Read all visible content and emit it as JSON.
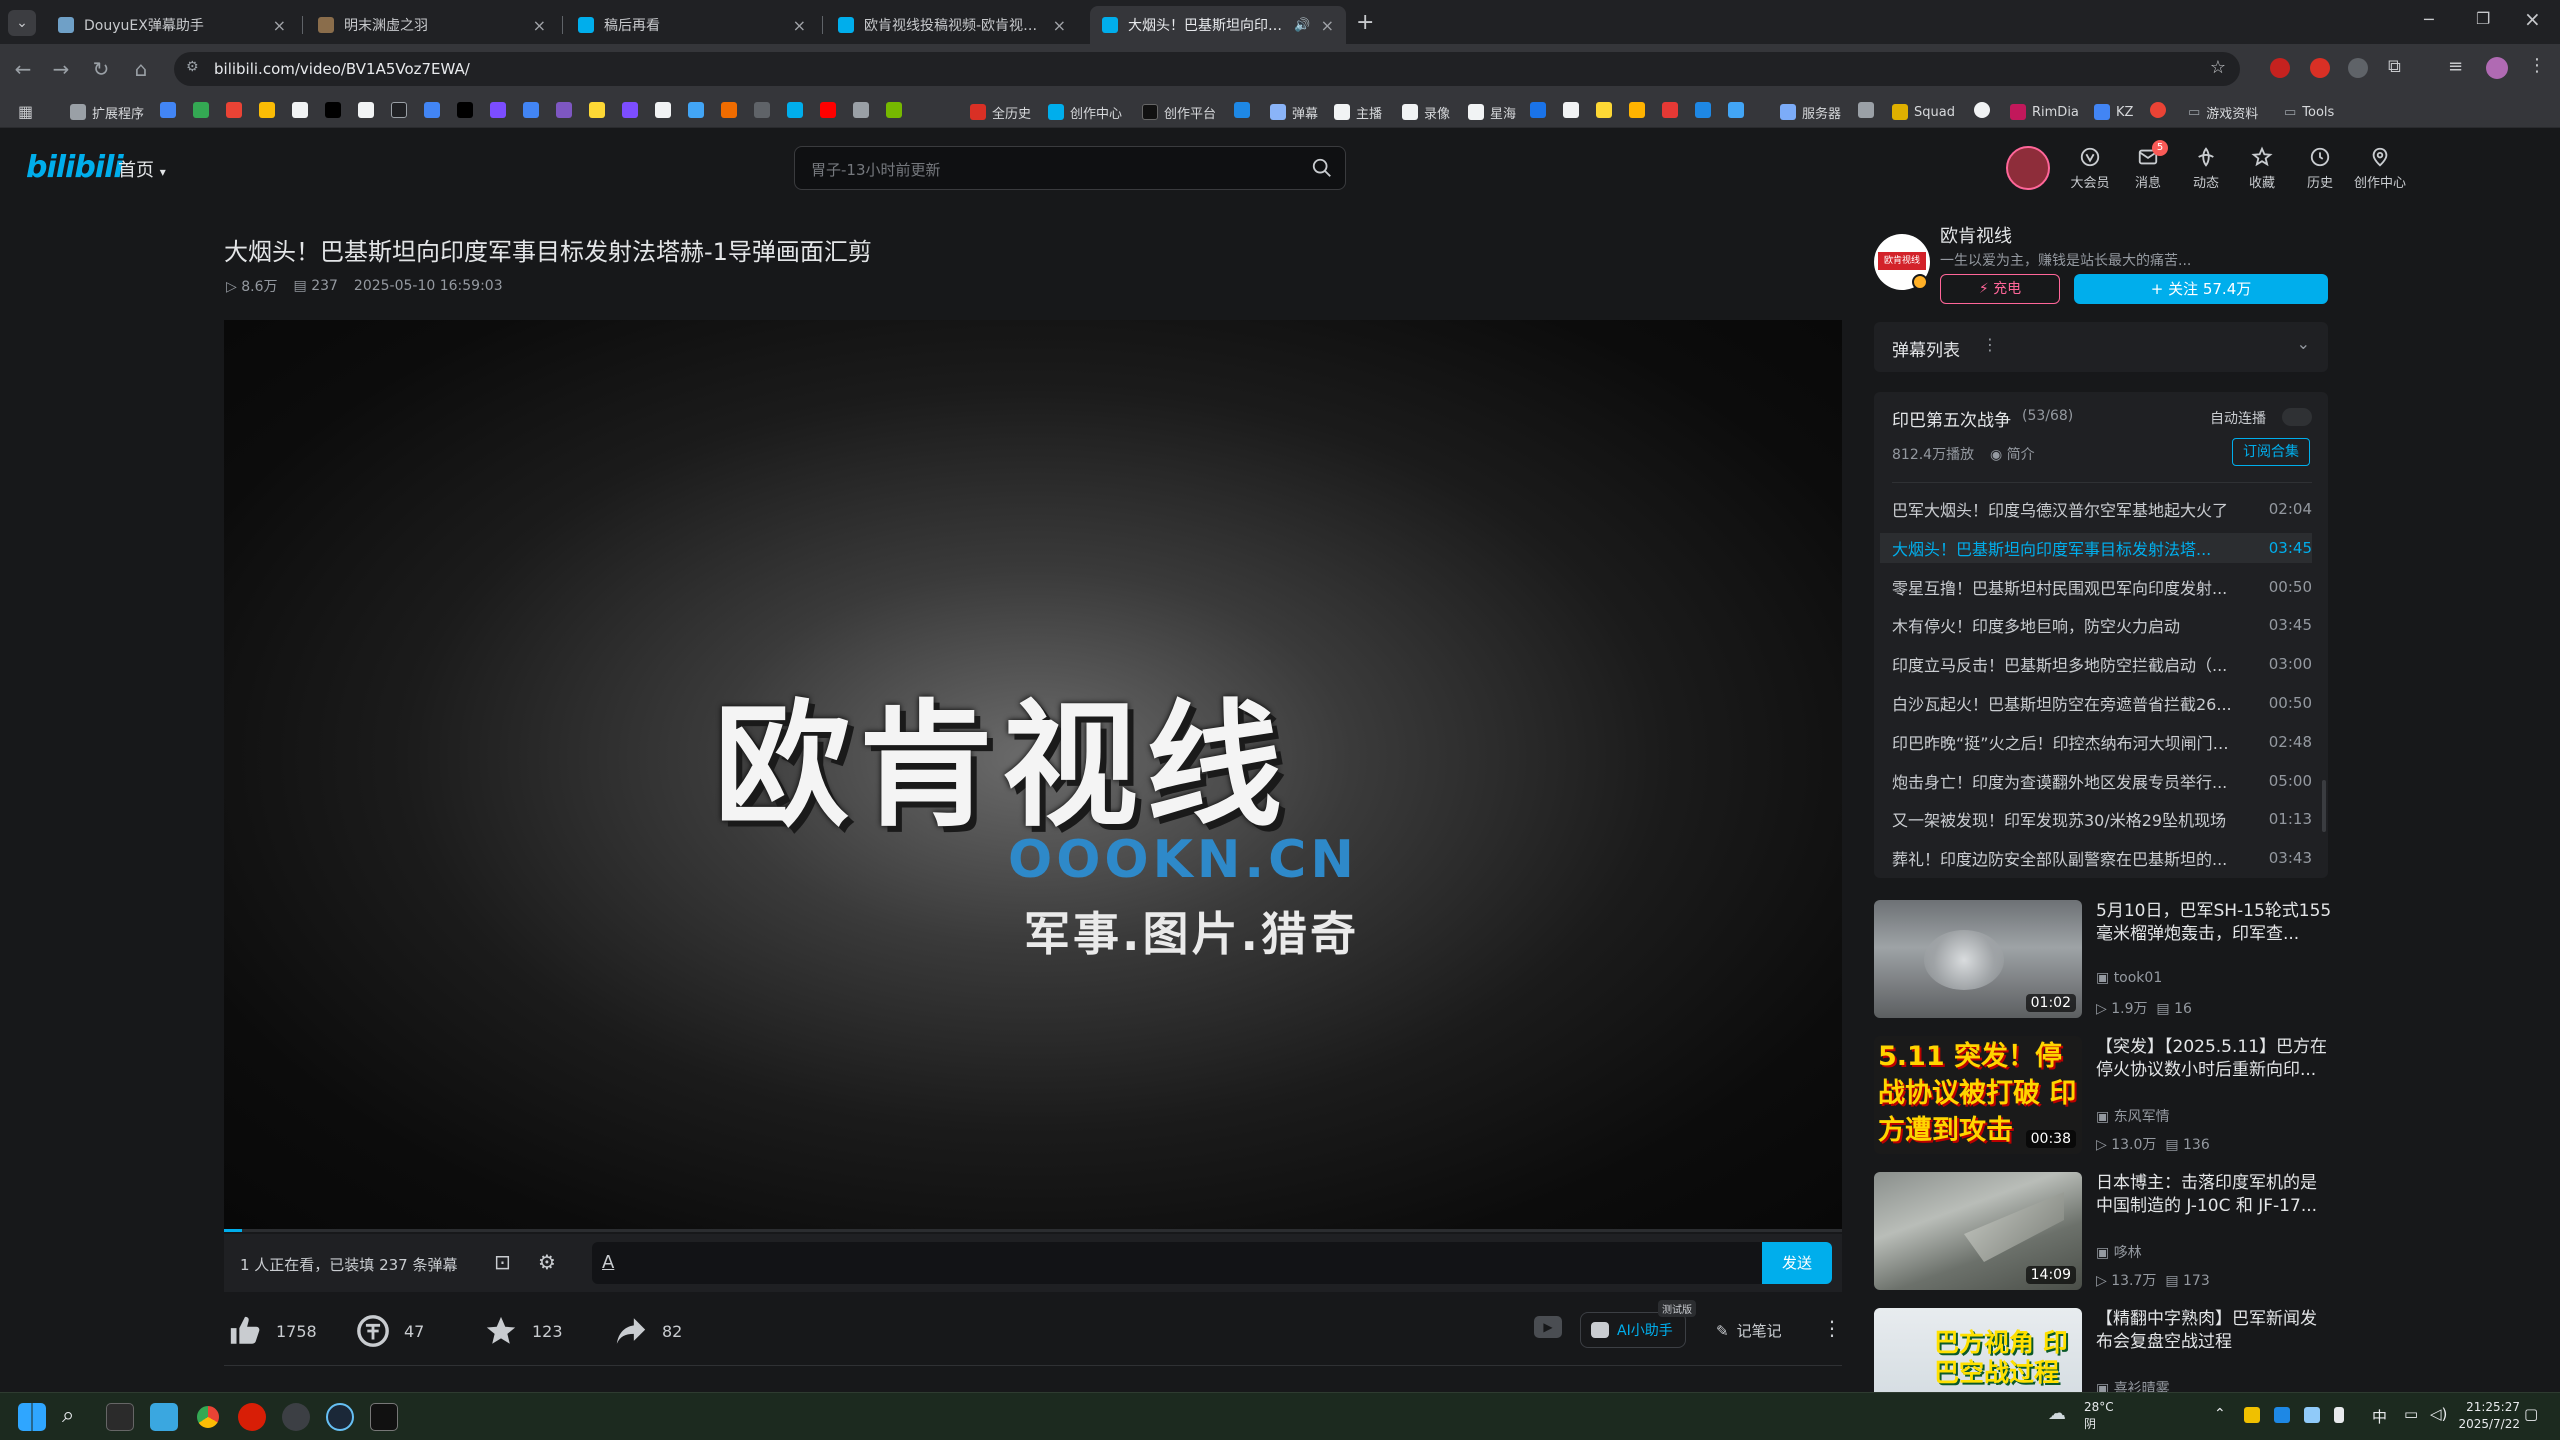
{
  "browser": {
    "tabs": [
      {
        "label": "DouyuEX弹幕助手",
        "fav": "#6fa0c7",
        "active": false
      },
      {
        "label": "明末渊虚之羽",
        "fav": "#8a6d4b",
        "active": false
      },
      {
        "label": "稿后再看",
        "fav": "#00aeec",
        "active": false
      },
      {
        "label": "欧肯视线投稿视频-欧肯视线视频",
        "fav": "#00aeec",
        "active": false
      },
      {
        "label": "大烟头！巴基斯坦向印度军事",
        "fav": "#00aeec",
        "active": true
      }
    ],
    "url": "bilibili.com/video/BV1A5Voz7EWA/",
    "bookmarks": [
      {
        "label": "扩展程序",
        "color": "#9aa0a6"
      },
      {
        "label": "全历史",
        "color": "#d93025"
      },
      {
        "label": "创作中心",
        "color": "#00aeec"
      },
      {
        "label": "创作平台",
        "color": "#111111"
      },
      {
        "label": "弹幕",
        "color": "#8ab4f8"
      },
      {
        "label": "主播",
        "color": "#f1f3f4"
      },
      {
        "label": "录像",
        "color": "#f1f3f4"
      },
      {
        "label": "星海",
        "color": "#f1f3f4"
      },
      {
        "label": "服务器",
        "color": "#7cacf8"
      },
      {
        "label": "Squad",
        "color": "#e0b000"
      },
      {
        "label": "RimDia",
        "color": "#c2185b"
      },
      {
        "label": "KZ",
        "color": "#4285f4"
      },
      {
        "label": "游戏资料",
        "color": "#9aa0a6"
      },
      {
        "label": "Tools",
        "color": "#9aa0a6"
      }
    ]
  },
  "site": {
    "logo": "bilibili",
    "home_label": "首页",
    "search_placeholder": "胃子-13小时前更新",
    "nav": [
      {
        "label": "大会员",
        "icon": "vip-icon"
      },
      {
        "label": "消息",
        "icon": "message-icon",
        "badge": "5"
      },
      {
        "label": "动态",
        "icon": "dynamic-icon"
      },
      {
        "label": "收藏",
        "icon": "favorite-icon"
      },
      {
        "label": "历史",
        "icon": "history-icon"
      },
      {
        "label": "创作中心",
        "icon": "creator-icon"
      }
    ]
  },
  "video": {
    "title": "大烟头！巴基斯坦向印度军事目标发射法塔赫-1导弹画面汇剪",
    "views": "8.6万",
    "danmaku_count": "237",
    "date": "2025-05-10 16:59:03",
    "frame": {
      "brand_name": "欧肯视线",
      "brand_url": "OOOKN.CN",
      "brand_tagline": "军事.图片.猎奇"
    },
    "progress_fraction": 0.011,
    "danmaku_status": "1 人正在看，已装填 237 条弹幕",
    "send_label": "发送",
    "likes": "1758",
    "coins": "47",
    "favorites": "123",
    "shares": "82",
    "ai_label": "AI小助手",
    "ai_badge": "测试版",
    "notes_label": "记笔记"
  },
  "uploader": {
    "name": "欧肯视线",
    "desc": "一生以爱为主，赚钱是站长最大的痛苦...",
    "charge_label": "充电",
    "follow_label": "+ 关注 57.4万"
  },
  "danmaku_list_label": "弹幕列表",
  "collection": {
    "title": "印巴第五次战争",
    "progress": "(53/68)",
    "autoplay_label": "自动连播",
    "plays": "812.4万播放",
    "intro_label": "简介",
    "subscribe_label": "订阅合集",
    "items": [
      {
        "title": "巴军大烟头！印度乌德汉普尔空军基地起大火了",
        "duration": "02:04",
        "active": false
      },
      {
        "title": "大烟头！巴基斯坦向印度军事目标发射法塔...",
        "duration": "03:45",
        "active": true
      },
      {
        "title": "零星互撸！巴基斯坦村民围观巴军向印度发射...",
        "duration": "00:50",
        "active": false
      },
      {
        "title": "木有停火！印度多地巨响，防空火力启动",
        "duration": "03:45",
        "active": false
      },
      {
        "title": "印度立马反击！巴基斯坦多地防空拦截启动（...",
        "duration": "03:00",
        "active": false
      },
      {
        "title": "白沙瓦起火！巴基斯坦防空在旁遮普省拦截26...",
        "duration": "00:50",
        "active": false
      },
      {
        "title": "印巴昨晚“挺”火之后！印控杰纳布河大坝闸门全...",
        "duration": "02:48",
        "active": false
      },
      {
        "title": "炮击身亡！印度为查谟翻外地区发展专员举行...",
        "duration": "05:00",
        "active": false
      },
      {
        "title": "又一架被发现！印军发现苏30/米格29坠机现场",
        "duration": "01:13",
        "active": false
      },
      {
        "title": "葬礼！印度边防安全部队副警察在巴基斯坦的...",
        "duration": "03:43",
        "active": false
      }
    ]
  },
  "recommendations": [
    {
      "title": "5月10日，巴军SH-15轮式155毫米榴弹炮轰击，印军查...",
      "author": "took01",
      "views": "1.9万",
      "danmaku": "16",
      "duration": "01:02",
      "thumb_text": ""
    },
    {
      "title": "【突发】【2025.5.11】巴方在停火协议数小时后重新向印...",
      "author": "东风军情",
      "views": "13.0万",
      "danmaku": "136",
      "duration": "00:38",
      "thumb_text": "5.11 突发！停战协议被打破 印方遭到攻击"
    },
    {
      "title": "日本博主：击落印度军机的是中国制造的 J-10C 和 JF-17...",
      "author": "哆林",
      "views": "13.7万",
      "danmaku": "173",
      "duration": "14:09",
      "thumb_text": ""
    },
    {
      "title": "【精翻中字熟肉】巴军新闻发布会复盘空战过程",
      "author": "喜衫晴雾",
      "views": "",
      "danmaku": "",
      "duration": "",
      "thumb_text": "巴方视角 印巴空战过程"
    }
  ],
  "taskbar": {
    "weather_temp": "28°C",
    "weather_desc": "阴",
    "ime": "中",
    "time": "21:25:27",
    "date": "2025/7/22"
  },
  "colors": {
    "accent": "#00aeec",
    "charge": "#ff6699",
    "background": "#17181a"
  }
}
